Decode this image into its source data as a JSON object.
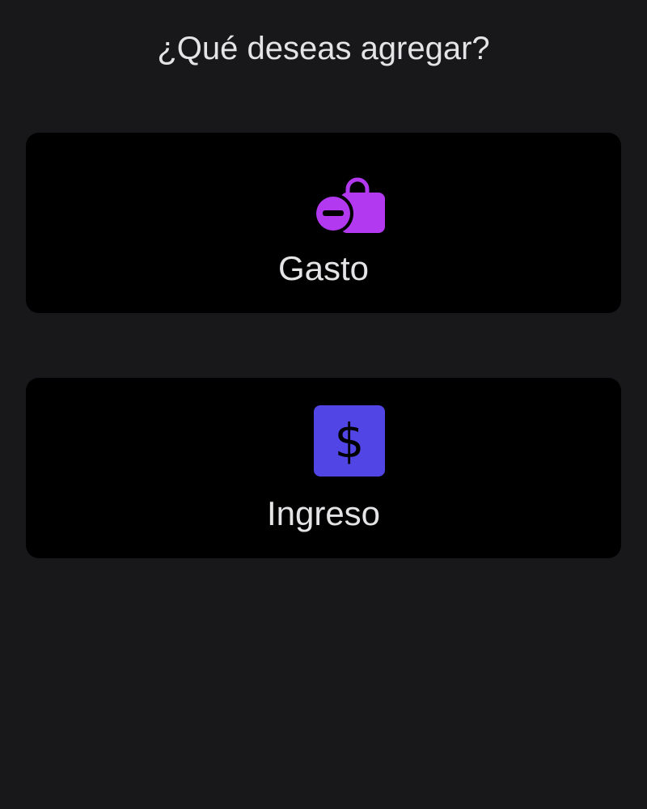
{
  "header": {
    "title": "¿Qué deseas agregar?"
  },
  "options": [
    {
      "label": "Gasto",
      "icon": "shopping-bag-minus-icon",
      "icon_color": "#b239f0"
    },
    {
      "label": "Ingreso",
      "icon": "dollar-sign-icon",
      "icon_color": "#5146e5"
    }
  ],
  "colors": {
    "background": "#18181b",
    "card_background": "#000000",
    "text": "#e4e4e7"
  }
}
